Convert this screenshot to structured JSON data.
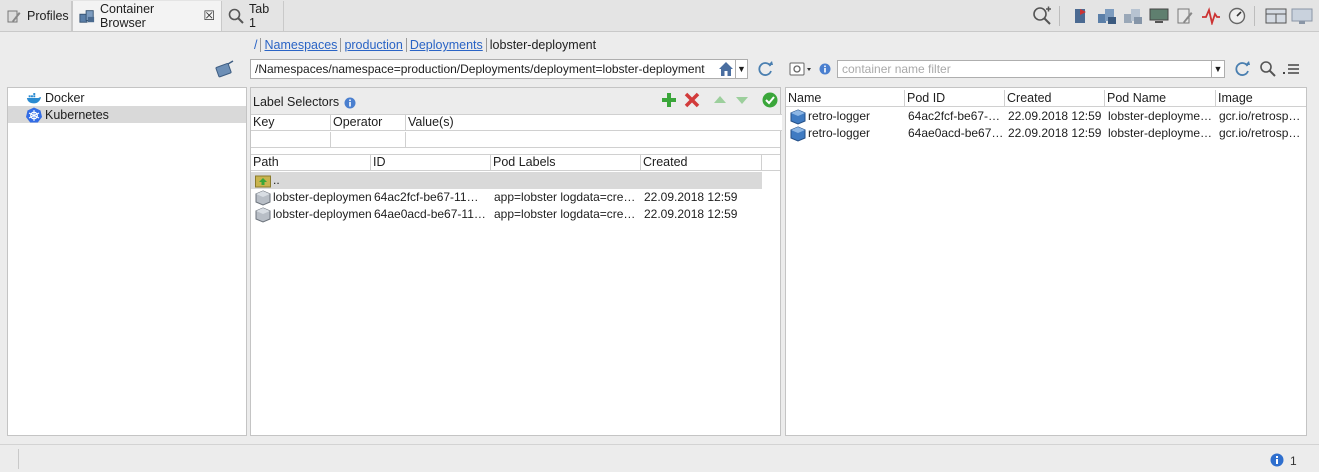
{
  "tabs": [
    {
      "label": "Profiles"
    },
    {
      "label": "Container Browser",
      "close": "☒"
    },
    {
      "label": "Tab 1"
    }
  ],
  "breadcrumb": {
    "root": "/",
    "items": [
      "Namespaces",
      "production",
      "Deployments"
    ],
    "current": "lobster-deployment"
  },
  "path": {
    "value": "/Namespaces/namespace=production/Deployments/deployment=lobster-deployment"
  },
  "filter": {
    "placeholder": "container name filter"
  },
  "tree": {
    "items": [
      {
        "label": "Docker",
        "icon": "docker-icon"
      },
      {
        "label": "Kubernetes",
        "icon": "kubernetes-icon",
        "selected": true
      }
    ]
  },
  "label_selectors": {
    "title": "Label Selectors",
    "columns": [
      "Key",
      "Operator",
      "Value(s)"
    ]
  },
  "pods": {
    "columns": [
      "Path",
      "ID",
      "Pod Labels",
      "Created"
    ],
    "parent": "..",
    "rows": [
      {
        "path": "lobster-deploymen",
        "id": "64ac2fcf-be67-11…",
        "labels": "app=lobster logdata=cre…",
        "created": "22.09.2018 12:59"
      },
      {
        "path": "lobster-deploymen",
        "id": "64ae0acd-be67-11…",
        "labels": "app=lobster logdata=cre…",
        "created": "22.09.2018 12:59"
      }
    ]
  },
  "containers": {
    "columns": [
      "Name",
      "Pod ID",
      "Created",
      "Pod Name",
      "Image"
    ],
    "rows": [
      {
        "name": "retro-logger",
        "pod_id": "64ac2fcf-be67-…",
        "created": "22.09.2018 12:59",
        "pod_name": "lobster-deployme…",
        "image": "gcr.io/retrosp…"
      },
      {
        "name": "retro-logger",
        "pod_id": "64ae0acd-be67…",
        "created": "22.09.2018 12:59",
        "pod_name": "lobster-deployme…",
        "image": "gcr.io/retrosp…"
      }
    ]
  },
  "status": {
    "count": "1"
  },
  "colors": {
    "link": "#2a64c5",
    "selection": "#d9d9d9",
    "accent_green": "#3aa63a",
    "accent_red": "#d23b3b",
    "info_blue": "#4a7fcf"
  }
}
